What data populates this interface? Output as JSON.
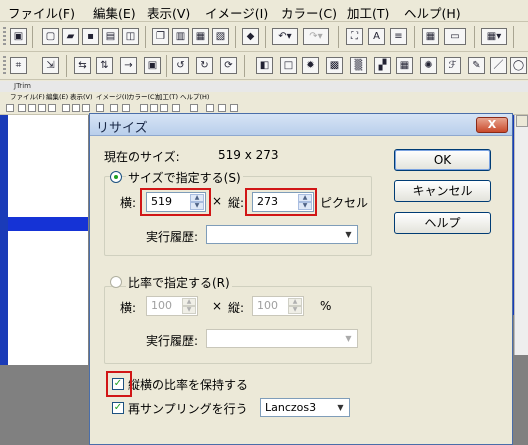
{
  "menu": [
    "ファイル(F)",
    "編集(E)",
    "表示(V)",
    "イメージ(I)",
    "カラー(C)",
    "加工(T)",
    "ヘルプ(H)"
  ],
  "inner_app": {
    "title": "JTrim",
    "menu": [
      "ファイル(F)",
      "編集(E)",
      "表示(V)",
      "イメージ(I)",
      "カラー(C)",
      "加工(T)",
      "ヘルプ(H)"
    ]
  },
  "dialog": {
    "title": "リサイズ",
    "current_size_label": "現在のサイズ:",
    "current_size_value": "519 x 273",
    "by_size": {
      "label": "サイズで指定する(S)",
      "selected": true,
      "width_label": "横:",
      "width_value": "519",
      "times": "×",
      "height_label": "縦:",
      "height_value": "273",
      "unit": "ピクセル",
      "history_label": "実行履歴:",
      "history_value": ""
    },
    "by_ratio": {
      "label": "比率で指定する(R)",
      "selected": false,
      "width_label": "横:",
      "width_value": "100",
      "times": "×",
      "height_label": "縦:",
      "height_value": "100",
      "unit": "%",
      "history_label": "実行履歴:",
      "history_value": ""
    },
    "keep_ratio": {
      "label": "縦横の比率を保持する",
      "checked": true
    },
    "resample": {
      "label": "再サンプリングを行う",
      "checked": true,
      "method": "Lanczos3"
    },
    "buttons": {
      "ok": "OK",
      "cancel": "キャンセル",
      "help": "ヘルプ"
    },
    "close": "X"
  },
  "colors": {
    "highlight": "#d11616",
    "title_bar": "#b9cfeb",
    "accent": "#21a121"
  }
}
